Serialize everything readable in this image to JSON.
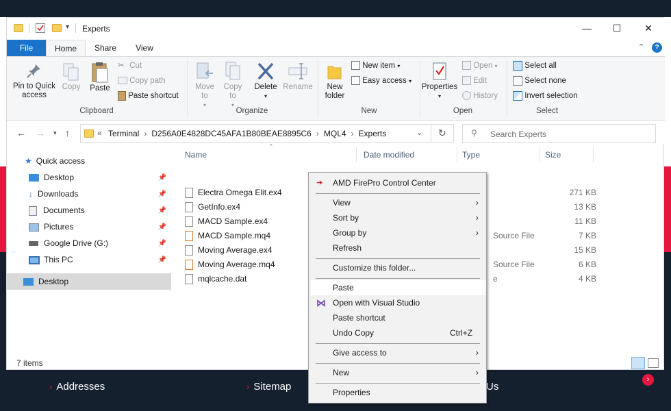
{
  "background": {
    "footer_links": [
      "Addresses",
      "Sitemap",
      "Us"
    ],
    "colors": {
      "dark": "#14202e",
      "red": "#e5173f"
    }
  },
  "window": {
    "title": "Experts",
    "controls": {
      "minimize": "—",
      "maximize": "☐",
      "close": "✕"
    }
  },
  "ribbon_tabs": [
    "File",
    "Home",
    "Share",
    "View"
  ],
  "ribbon": {
    "clipboard": {
      "group": "Clipboard",
      "pin": "Pin to Quick access",
      "copy": "Copy",
      "paste": "Paste",
      "cut": "Cut",
      "copy_path": "Copy path",
      "paste_shortcut": "Paste shortcut"
    },
    "organize": {
      "group": "Organize",
      "move_to": "Move to",
      "copy_to": "Copy to",
      "delete": "Delete",
      "rename": "Rename"
    },
    "new": {
      "group": "New",
      "new_folder": "New folder",
      "new_item": "New item",
      "easy_access": "Easy access"
    },
    "open": {
      "group": "Open",
      "properties": "Properties",
      "open": "Open",
      "edit": "Edit",
      "history": "History"
    },
    "select": {
      "group": "Select",
      "select_all": "Select all",
      "select_none": "Select none",
      "invert": "Invert selection"
    }
  },
  "address": {
    "path": [
      "Terminal",
      "D256A0E4828DC45AFA1B80BEAE8895C6",
      "MQL4",
      "Experts"
    ],
    "search_placeholder": "Search Experts"
  },
  "nav": {
    "items": [
      {
        "label": "Quick access",
        "icon": "star-icon"
      },
      {
        "label": "Desktop",
        "icon": "desktop-icon"
      },
      {
        "label": "Downloads",
        "icon": "download-icon"
      },
      {
        "label": "Documents",
        "icon": "document-icon"
      },
      {
        "label": "Pictures",
        "icon": "picture-icon"
      },
      {
        "label": "Google Drive (G:)",
        "icon": "drive-icon"
      },
      {
        "label": "This PC",
        "icon": "computer-icon"
      },
      {
        "label": "Desktop",
        "icon": "desktop-icon"
      }
    ]
  },
  "columns": [
    "Name",
    "Date modified",
    "Type",
    "Size"
  ],
  "files": [
    {
      "name": "Electra Omega Elit.ex4",
      "type": "",
      "size": "271 KB"
    },
    {
      "name": "GetInfo.ex4",
      "type": "",
      "size": "13 KB"
    },
    {
      "name": "MACD Sample.ex4",
      "type": "",
      "size": "11 KB"
    },
    {
      "name": "MACD Sample.mq4",
      "type": "Source File",
      "size": "7 KB"
    },
    {
      "name": "Moving Average.ex4",
      "type": "",
      "size": "15 KB"
    },
    {
      "name": "Moving Average.mq4",
      "type": "Source File",
      "size": "6 KB"
    },
    {
      "name": "mqlcache.dat",
      "type": "e",
      "size": "4 KB"
    }
  ],
  "status": {
    "count": "7 items"
  },
  "context_menu": {
    "items": [
      {
        "label": "AMD FirePro Control Center"
      },
      {
        "label": "View"
      },
      {
        "label": "Sort by"
      },
      {
        "label": "Group by"
      },
      {
        "label": "Refresh"
      },
      {
        "label": "Customize this folder..."
      },
      {
        "label": "Paste"
      },
      {
        "label": "Open with Visual Studio"
      },
      {
        "label": "Paste shortcut"
      },
      {
        "label": "Undo Copy",
        "shortcut": "Ctrl+Z"
      },
      {
        "label": "Give access to"
      },
      {
        "label": "New"
      },
      {
        "label": "Properties"
      }
    ]
  }
}
